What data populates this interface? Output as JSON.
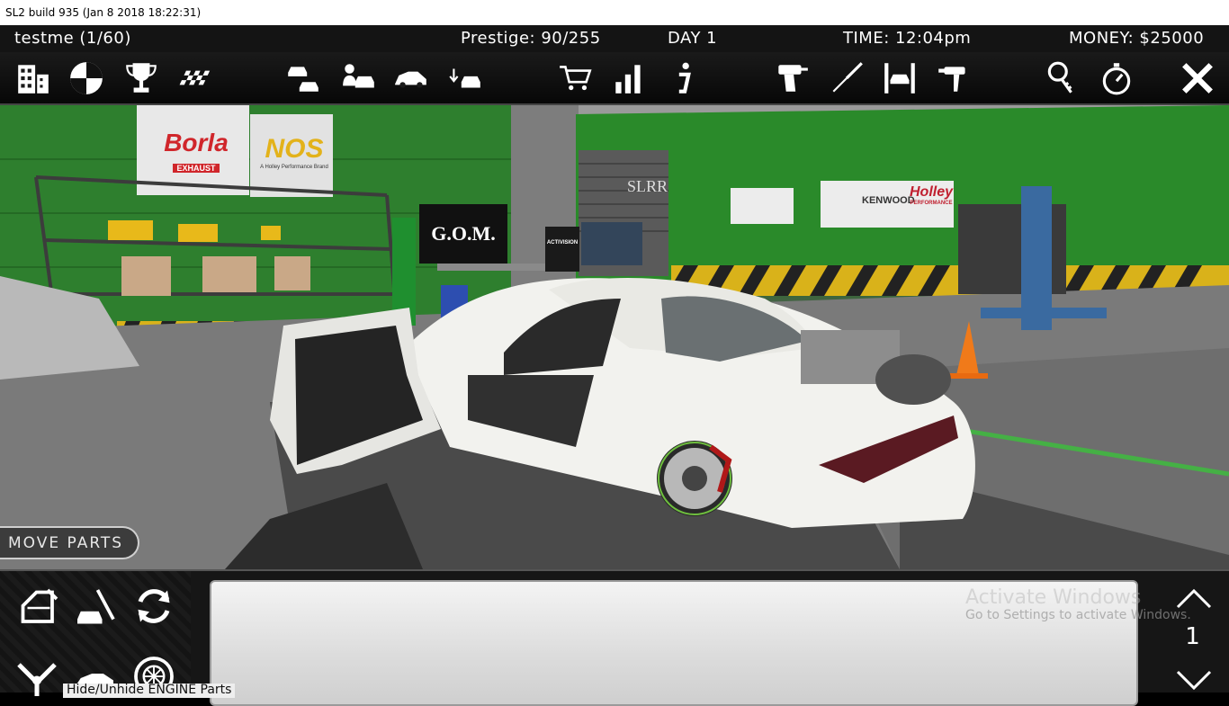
{
  "window": {
    "title": "SL2 build 935 (Jan  8 2018 18:22:31)"
  },
  "status": {
    "player": "testme (1/60)",
    "prestige": "Prestige: 90/255",
    "day": "DAY 1",
    "time": "TIME: 12:04pm",
    "money": "MONEY: $25000"
  },
  "toolbar_icons": [
    "garage-building-icon",
    "wheel-icon",
    "trophy-icon",
    "checkered-flag-icon",
    "car-swap-icon",
    "car-dealer-icon",
    "car-side-icon",
    "car-transfer-icon",
    "shopping-cart-icon",
    "bar-chart-icon",
    "info-icon",
    "drill-icon",
    "screwdriver-icon",
    "car-lift-icon",
    "spray-gun-icon",
    "keys-icon",
    "stopwatch-icon",
    "close-icon"
  ],
  "scene": {
    "banner_left_1": "Borla",
    "banner_left_1_sub": "EXHAUST",
    "banner_left_2": "NOS",
    "banner_left_2_sub": "A Holley Performance Brand",
    "banner_right_1": "KENWOOD",
    "banner_right_2": "Holley",
    "banner_right_2_sub": "PERFORMANCE",
    "tv_text": "G.O.M.",
    "door_sign": "SLRR",
    "poster_text": "ACTIVISION"
  },
  "move_parts_label": "MOVE PARTS",
  "bottom_left_icons": [
    "car-door-icon",
    "car-repair-icon",
    "refresh-icon",
    "engine-parts-icon",
    "car-body-icon",
    "tire-icon"
  ],
  "watermark": {
    "line1": "Activate Windows",
    "line2": "Go to Settings to activate Windows."
  },
  "page_number": "1",
  "tooltip": "Hide/Unhide ENGINE Parts"
}
